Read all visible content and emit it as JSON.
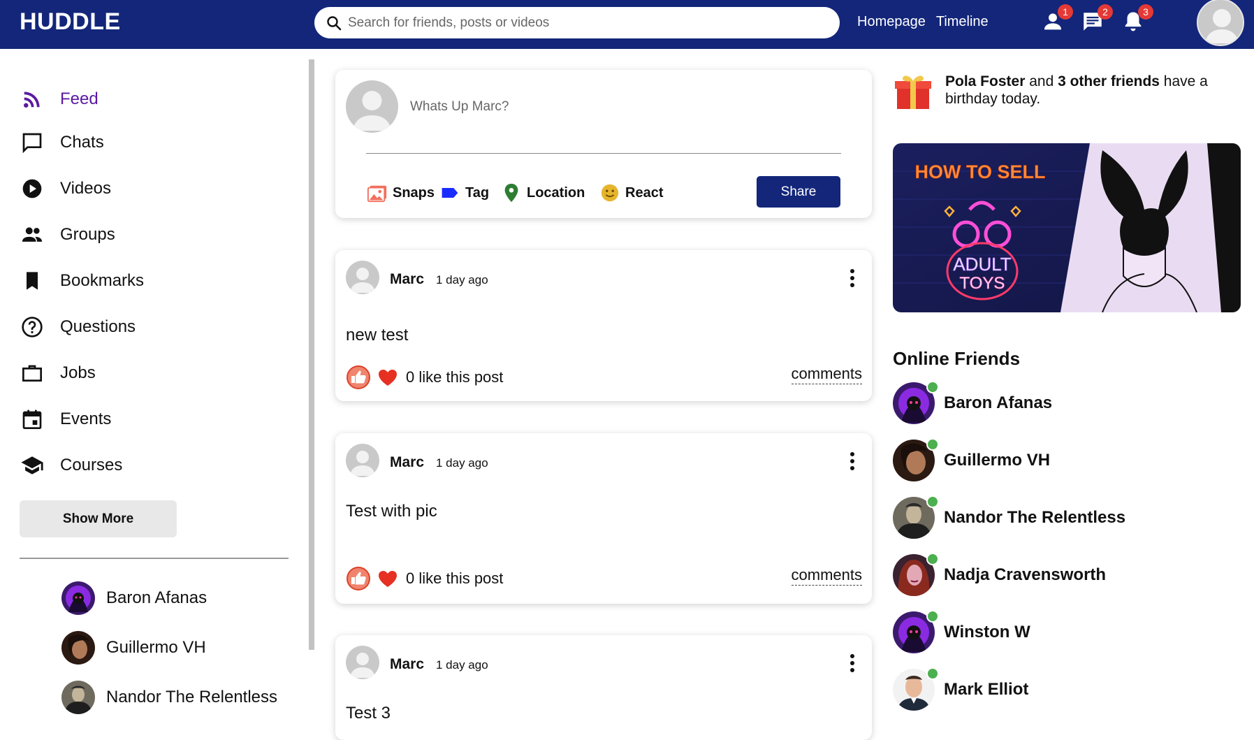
{
  "app": {
    "logo": "HUDDLE"
  },
  "search": {
    "placeholder": "Search for friends, posts or videos"
  },
  "topnav": {
    "links": [
      "Homepage",
      "Timeline"
    ],
    "badges": {
      "friends": "1",
      "messages": "2",
      "notifications": "3"
    }
  },
  "sidebar": {
    "items": [
      {
        "label": "Feed",
        "icon": "rss-feed-icon"
      },
      {
        "label": "Chats",
        "icon": "chat-icon"
      },
      {
        "label": "Videos",
        "icon": "play-circle-icon"
      },
      {
        "label": "Groups",
        "icon": "group-icon"
      },
      {
        "label": "Bookmarks",
        "icon": "bookmark-icon"
      },
      {
        "label": "Questions",
        "icon": "question-icon"
      },
      {
        "label": "Jobs",
        "icon": "briefcase-icon"
      },
      {
        "label": "Events",
        "icon": "calendar-icon"
      },
      {
        "label": "Courses",
        "icon": "school-icon"
      }
    ],
    "show_more": "Show More",
    "friends": [
      "Baron Afanas",
      "Guillermo VH",
      "Nandor The Relentless"
    ]
  },
  "composer": {
    "placeholder": "Whats Up Marc?",
    "options": [
      "Snaps",
      "Tag",
      "Location",
      "React"
    ],
    "share": "Share"
  },
  "posts": [
    {
      "author": "Marc",
      "time": "1 day ago",
      "text": "new test",
      "likes": "0 like this post",
      "comments": "comments"
    },
    {
      "author": "Marc",
      "time": "1 day ago",
      "text": "Test with pic",
      "likes": "0 like this post",
      "comments": "comments"
    },
    {
      "author": "Marc",
      "time": "1 day ago",
      "text": "Test 3"
    }
  ],
  "birthday": {
    "name": "Pola Foster",
    "and": " and ",
    "others": "3 other friends",
    "rest": " have a birthday today."
  },
  "ad": {
    "line1": "HOW TO SELL",
    "line2": "ADULT",
    "line3": "TOYS"
  },
  "online": {
    "title": "Online Friends",
    "friends": [
      "Baron Afanas",
      "Guillermo VH",
      "Nandor The Relentless",
      "Nadja Cravensworth",
      "Winston W",
      "Mark Elliot"
    ]
  },
  "colors": {
    "brand": "#13267a",
    "active": "#5a1aa0",
    "badge": "#e53935",
    "online": "#4caf50"
  }
}
